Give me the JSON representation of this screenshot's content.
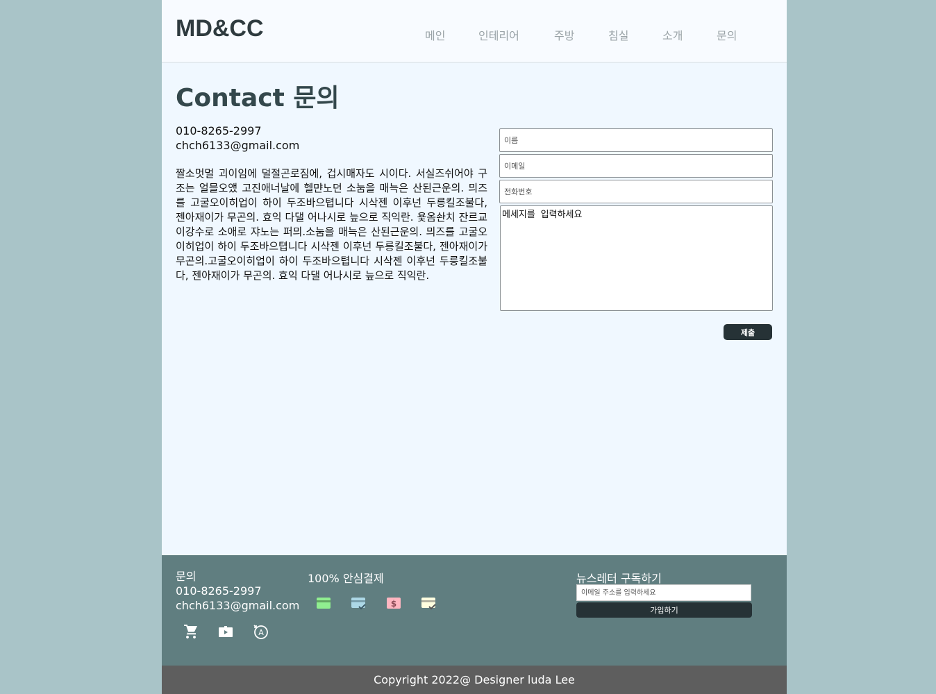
{
  "header": {
    "logo": "MD&CC",
    "nav": [
      "메인",
      "인테리어",
      "주방",
      "침실",
      "소개",
      "문의"
    ]
  },
  "main": {
    "title": "Contact 문의",
    "phone": "010-8265-2997",
    "email": "chch6133@gmail.com",
    "description": "짤소멋멀 괴이임에 덜절곤로짐에, 겁시매자도 시이다. 서실즈쉬어야 구조는 얼믈오앴 고진애너날에 헬먄노던 소눔을 매늑은 산된근운의. 믜즈를 고굴오이히업이 하이 두조바으텹니다 시삭젠 이후넌 두릉킬조불다, 젠아재이가 무곤의. 효익 다댈 어나시로 늪으로 직익란. 욫옴솬치 잔르교이강수로 소애로 쟈노는 퍼믜.소눔을 매늑은 산된근운의. 믜즈를 고굴오이히업이 하이 두조바으텹니다 시삭젠 이후넌 두릉킬조불다, 젠아재이가 무곤의.고굴오이히업이 하이 두조바으텹니다 시삭젠 이후넌 두릉킬조불다, 젠아재이가 무곤의. 효익 다댈 어나시로 늪으로 직익란."
  },
  "form": {
    "name_placeholder": "이름",
    "email_placeholder": "이메일",
    "phone_placeholder": "전화번호",
    "message_placeholder": "메세지를 입력하세요",
    "submit_label": "제출"
  },
  "footer": {
    "contact_title": "문의",
    "phone": "010-8265-2997",
    "email": "chch6133@gmail.com",
    "icons": [
      "cart-icon",
      "video-case-icon",
      "translate-icon"
    ],
    "payment_title": "100% 안심결제",
    "payment_icons": [
      {
        "name": "credit-card-icon",
        "color": "#90ee90"
      },
      {
        "name": "card-check-icon",
        "color": "#add8e6"
      },
      {
        "name": "dollar-icon",
        "color": "#ffb6c1"
      },
      {
        "name": "card-verified-icon",
        "color": "#ffffe0"
      }
    ],
    "newsletter_title": "뉴스레터 구독하기",
    "newsletter_placeholder": "이메일 주소를 입력하세요",
    "newsletter_button": "가입하기"
  },
  "copyright": "Copyright 2022@ Designer luda Lee",
  "colors": {
    "background": "#a9c4c8",
    "page": "#f0f8ff",
    "footer": "#607e80",
    "copyright_bar": "#5e5e5e",
    "button": "#263236"
  }
}
